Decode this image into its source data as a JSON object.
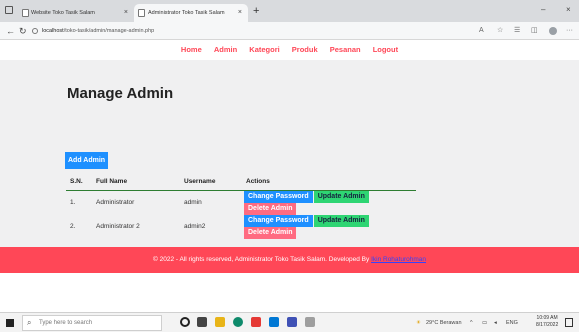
{
  "browser": {
    "tabs": [
      {
        "title": "Website Toko Tasik Salam",
        "active": false
      },
      {
        "title": "Administrator Toko Tasik Salam",
        "active": true
      }
    ],
    "new_tab_glyph": "+",
    "window_controls": {
      "minimize": "–",
      "close": "×"
    },
    "address": {
      "host": "localhost",
      "path": "/toko-tasik/admin/manage-admin.php"
    },
    "toolbar_icons": [
      "read-aloud-icon",
      "favorite-icon",
      "collections-icon",
      "extensions-icon",
      "profile-icon",
      "more-icon"
    ]
  },
  "site_menu": {
    "items": [
      "Home",
      "Admin",
      "Kategori",
      "Produk",
      "Pesanan",
      "Logout"
    ]
  },
  "main": {
    "title": "Manage Admin",
    "add_button": "Add Admin",
    "table": {
      "headers": [
        "S.N.",
        "Full Name",
        "Username",
        "Actions"
      ],
      "rows": [
        {
          "sn": "1.",
          "full_name": "Administrator",
          "username": "admin"
        },
        {
          "sn": "2.",
          "full_name": "Administrator 2",
          "username": "admin2"
        }
      ],
      "actions": {
        "change_password": "Change Password",
        "update": "Update Admin",
        "delete": "Delete Admin"
      }
    }
  },
  "footer": {
    "text": "© 2022 - All rights reserved, Administrator Toko Tasik Salam. Developed By ",
    "link": "Ikin Rohaturohman"
  },
  "taskbar": {
    "search_placeholder": "Type here to search",
    "weather": "29°C Berawan",
    "language": "ENG",
    "time": "10:09 AM",
    "date": "8/17/2022"
  },
  "colors": {
    "accent_red": "#ff4757",
    "primary_blue": "#1e90ff",
    "success_green": "#2ed573",
    "danger_pink": "#ff6b81",
    "content_bg": "#f0f0f1"
  }
}
